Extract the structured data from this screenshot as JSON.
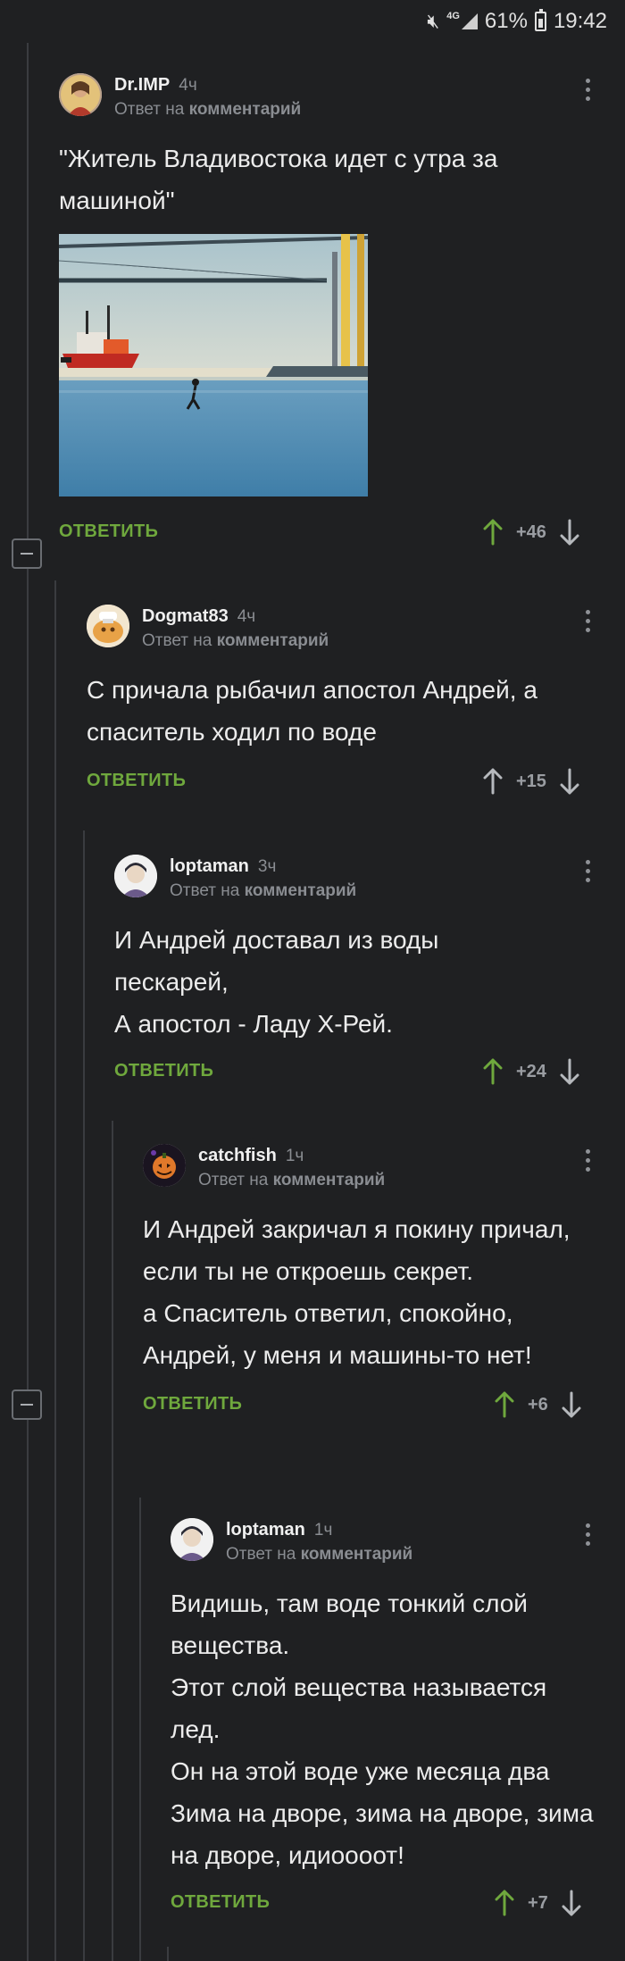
{
  "status_bar": {
    "time": "19:42",
    "battery": "61%",
    "network": "4G"
  },
  "comments": [
    {
      "user": "Dr.IMP",
      "time": "4ч",
      "reply_prefix": "Ответ на",
      "reply_target": "комментарий",
      "text": "\"Житель Владивостока идет с утра за машиной\"",
      "reply_label": "ОТВЕТИТЬ",
      "rating": "+46"
    },
    {
      "user": "Dogmat83",
      "time": "4ч",
      "reply_prefix": "Ответ на",
      "reply_target": "комментарий",
      "text": "С причала рыбачил апостол Андрей, а спаситель ходил по воде",
      "reply_label": "ОТВЕТИТЬ",
      "rating": "+15"
    },
    {
      "user": "loptaman",
      "time": "3ч",
      "reply_prefix": "Ответ на",
      "reply_target": "комментарий",
      "text": "И Андрей доставал из воды пескарей,\nА апостол - Ладу Х-Рей.",
      "reply_label": "ОТВЕТИТЬ",
      "rating": "+24"
    },
    {
      "user": "catchfish",
      "time": "1ч",
      "reply_prefix": "Ответ на",
      "reply_target": "комментарий",
      "text": "И Андрей закричал я покину причал,\nесли ты не откроешь секрет.\nа Спаситель ответил, спокойно, Андрей, у меня и машины-то нет!",
      "reply_label": "ОТВЕТИТЬ",
      "rating": "+6"
    },
    {
      "user": "loptaman",
      "time": "1ч",
      "reply_prefix": "Ответ на",
      "reply_target": "комментарий",
      "text": "Видишь, там воде тонкий слой вещества.\nЭтот слой вещества называется лед.\nОн на этой воде уже месяца два\nЗима на дворе, зима на дворе, зима на дворе, идиоооот!",
      "reply_label": "ОТВЕТИТЬ",
      "rating": "+7"
    }
  ],
  "colors": {
    "background": "#1f2022",
    "reply_green": "#6fa83d",
    "upvote_green": "#6fa83d",
    "muted": "#8a8d92"
  }
}
